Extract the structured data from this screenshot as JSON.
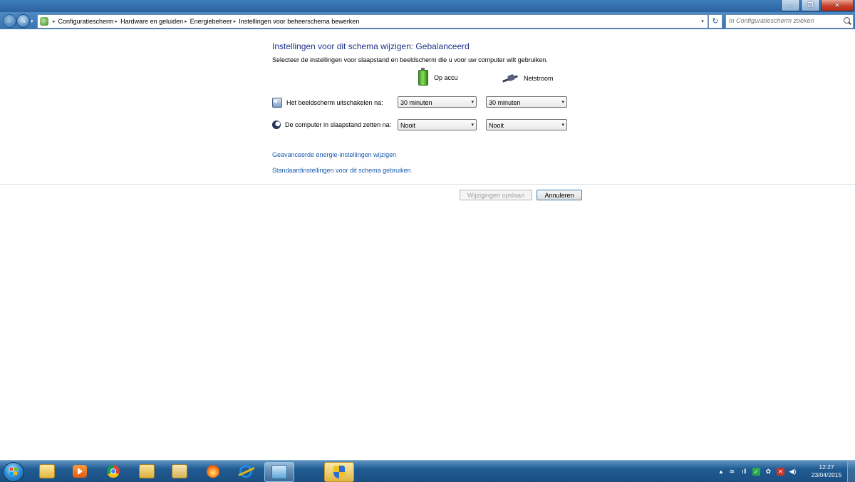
{
  "window": {
    "minimize_glyph": "–",
    "maximize_glyph": "❐",
    "close_glyph": "✕"
  },
  "nav": {
    "back_glyph": "←",
    "forward_glyph": "→",
    "dropdown_glyph": "▾"
  },
  "breadcrumb": {
    "separator": "▸",
    "items": [
      "Configuratiescherm",
      "Hardware en geluiden",
      "Energiebeheer",
      "Instellingen voor beheerschema bewerken"
    ],
    "dropdown_glyph": "▾"
  },
  "refresh": {
    "glyph": "↻"
  },
  "search": {
    "placeholder": "In Configuratiescherm zoeken"
  },
  "main": {
    "title": "Instellingen voor dit schema wijzigen: Gebalanceerd",
    "description": "Selecteer de instellingen voor slaapstand en beeldscherm die u voor uw computer wilt gebruiken.",
    "columns": {
      "battery": "Op accu",
      "plugged": "Netstroom"
    },
    "settings": [
      {
        "label": "Het beeldscherm uitschakelen na:",
        "icon": "monitor-icon",
        "battery_value": "30 minuten",
        "plugged_value": "30 minuten"
      },
      {
        "label": "De computer in slaapstand zetten na:",
        "icon": "moon-icon",
        "battery_value": "Nooit",
        "plugged_value": "Nooit"
      }
    ],
    "dropdown_arrow": "▾",
    "links": {
      "advanced": "Geavanceerde energie-instellingen wijzigen",
      "restore": "Standaardinstellingen voor dit schema gebruiken"
    },
    "buttons": {
      "save": "Wijzigingen opslaan",
      "cancel": "Annuleren"
    }
  },
  "taskbar": {
    "apps": [
      "folder-icon",
      "media-player-icon",
      "chrome-icon",
      "explorer-icon",
      "mail-icon",
      "fire-icon",
      "ie-icon",
      "control-panel-icon",
      "shield-icon"
    ],
    "tray": {
      "up_glyph": "▲",
      "check_glyph": "✓",
      "red_glyph": "✕",
      "volume_glyph": "◀)",
      "signal_glyph": "ıll"
    },
    "clock": {
      "time": "12:27",
      "date": "23/04/2015"
    }
  },
  "colors": {
    "title": "#1e3287",
    "link": "#1a5bad",
    "taskbar": "#1f5b92"
  }
}
